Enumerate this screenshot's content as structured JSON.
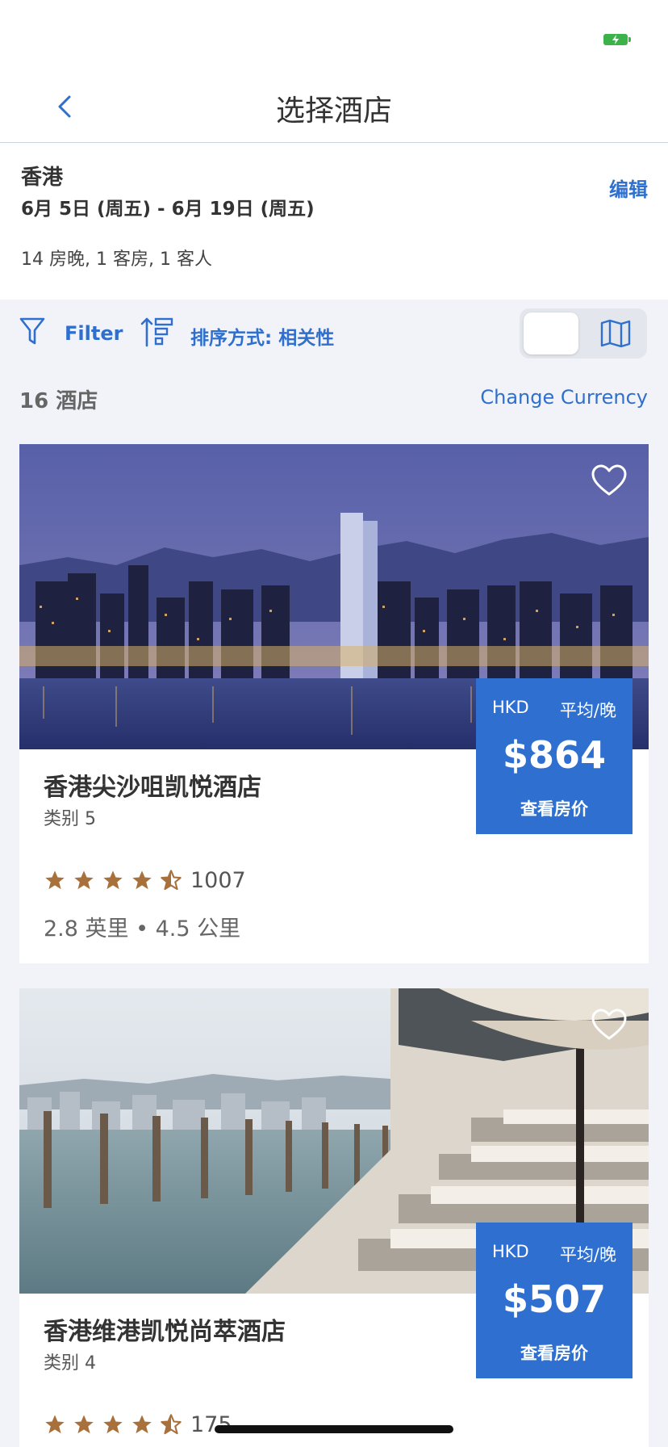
{
  "nav": {
    "title": "选择酒店"
  },
  "search": {
    "city": "香港",
    "dates": "6月 5日 (周五) - 6月 19日 (周五)",
    "details": "14 房晚, 1 客房, 1 客人",
    "edit_label": "编辑"
  },
  "toolbar": {
    "filter_label": "Filter",
    "sort_label": "排序方式: 相关性"
  },
  "results": {
    "count_label": "16 酒店",
    "currency_label": "Change Currency"
  },
  "hotels": [
    {
      "name": "香港尖沙咀凯悦酒店",
      "category": "类别 5",
      "currency": "HKD",
      "per_night": "平均/晚",
      "price": "$864",
      "view_rates": "查看房价",
      "rating": 4.5,
      "reviews": "1007",
      "distance": "2.8 英里 • 4.5 公里"
    },
    {
      "name": "香港维港凯悦尚萃酒店",
      "category": "类别 4",
      "currency": "HKD",
      "per_night": "平均/晚",
      "price": "$507",
      "view_rates": "查看房价",
      "rating": 4.5,
      "reviews": "175",
      "distance": ""
    }
  ],
  "colors": {
    "accent": "#2f6fcd",
    "star": "#a8703a",
    "background": "#f1f3f8"
  }
}
